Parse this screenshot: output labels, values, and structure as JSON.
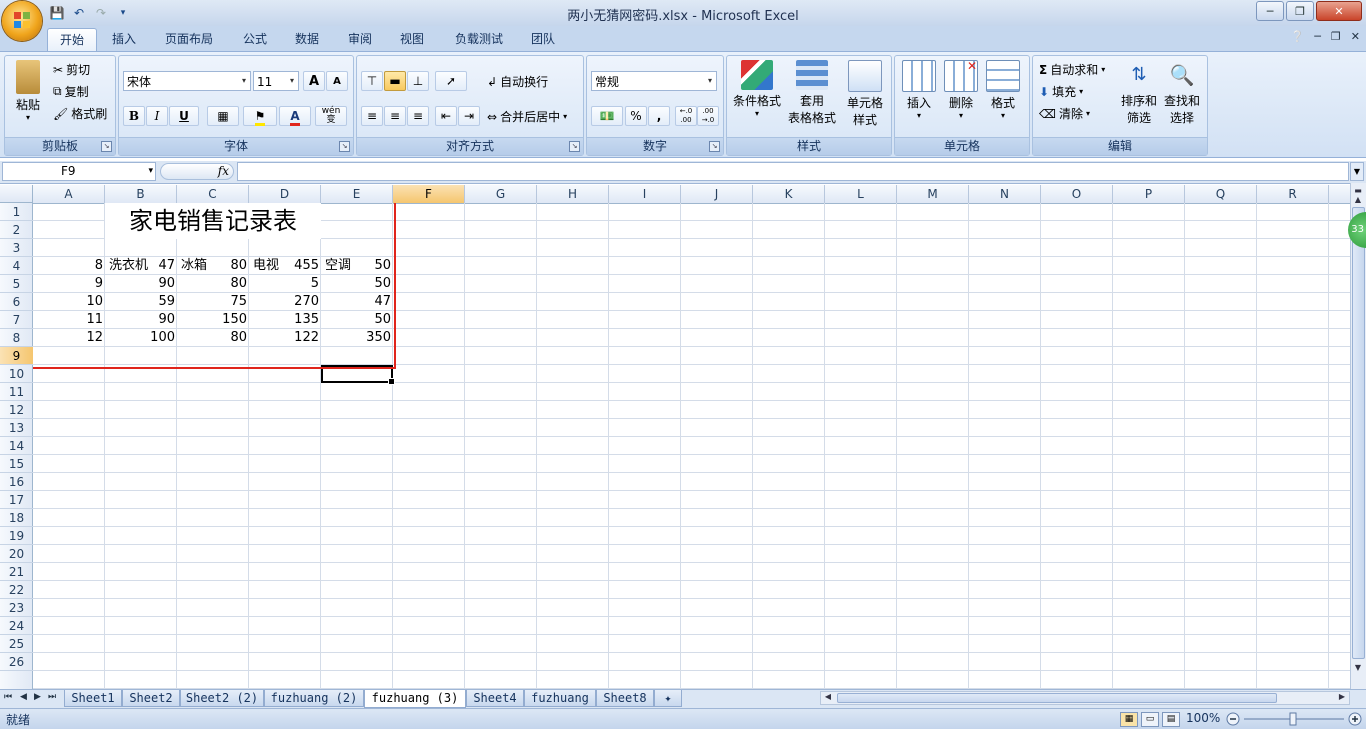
{
  "window": {
    "title": "两小无猜网密码.xlsx - Microsoft Excel",
    "controls": [
      "minimize",
      "restore",
      "close"
    ]
  },
  "ribbon_tabs": [
    {
      "label": "开始",
      "active": true
    },
    {
      "label": "插入"
    },
    {
      "label": "页面布局"
    },
    {
      "label": "公式"
    },
    {
      "label": "数据"
    },
    {
      "label": "审阅"
    },
    {
      "label": "视图"
    },
    {
      "label": "负载测试"
    },
    {
      "label": "团队"
    }
  ],
  "ribbon": {
    "clipboard": {
      "group": "剪贴板",
      "paste": "粘贴",
      "cut": "剪切",
      "copy": "复制",
      "format_painter": "格式刷"
    },
    "font": {
      "group": "字体",
      "name": "宋体",
      "size": "11",
      "bold": "B",
      "italic": "I",
      "underline": "U",
      "grow": "A",
      "shrink": "A",
      "phonetic": "wén 变"
    },
    "alignment": {
      "group": "对齐方式",
      "wrap": "自动换行",
      "merge": "合并后居中"
    },
    "number": {
      "group": "数字",
      "format": "常规",
      "percent": "%",
      "comma": ",",
      "inc_decimal": "←.0 .00",
      "dec_decimal": ".00 →.0"
    },
    "styles": {
      "group": "样式",
      "conditional": "条件格式",
      "table_1": "套用",
      "table_2": "表格格式",
      "cell_1": "单元格",
      "cell_2": "样式"
    },
    "cells": {
      "group": "单元格",
      "insert": "插入",
      "delete": "删除",
      "format": "格式"
    },
    "editing": {
      "group": "编辑",
      "autosum": "自动求和",
      "fill": "填充",
      "clear": "清除",
      "sort_1": "排序和",
      "sort_2": "筛选",
      "find_1": "查找和",
      "find_2": "选择"
    }
  },
  "formula_bar": {
    "name_box": "F9",
    "fx": "fx",
    "formula": ""
  },
  "columns": [
    "A",
    "B",
    "C",
    "D",
    "E",
    "F",
    "G",
    "H",
    "I",
    "J",
    "K",
    "L",
    "M",
    "N",
    "O",
    "P",
    "Q",
    "R",
    "S"
  ],
  "selected_column": "F",
  "rows": [
    "1",
    "2",
    "3",
    "4",
    "5",
    "6",
    "7",
    "8",
    "9",
    "10",
    "11",
    "12",
    "13",
    "14",
    "15",
    "16",
    "17",
    "18",
    "19",
    "20",
    "21",
    "22",
    "23",
    "24",
    "25",
    "26"
  ],
  "selected_row": "9",
  "sheet": {
    "title": "家电销售记录表",
    "headers": [
      "洗衣机",
      "冰箱",
      "电视",
      "空调"
    ],
    "data": [
      [
        "8",
        "47",
        "80",
        "455",
        "50"
      ],
      [
        "9",
        "90",
        "80",
        "5",
        "50"
      ],
      [
        "10",
        "59",
        "75",
        "270",
        "47"
      ],
      [
        "11",
        "90",
        "150",
        "135",
        "50"
      ],
      [
        "12",
        "100",
        "80",
        "122",
        "350"
      ]
    ]
  },
  "sheet_tabs": [
    {
      "label": "Sheet1"
    },
    {
      "label": "Sheet2"
    },
    {
      "label": "Sheet2 (2)"
    },
    {
      "label": "fuzhuang (2)"
    },
    {
      "label": "fuzhuang (3)",
      "active": true
    },
    {
      "label": "Sheet4"
    },
    {
      "label": "fuzhuang"
    },
    {
      "label": "Sheet8"
    }
  ],
  "status": {
    "text": "就绪",
    "zoom": "100%"
  },
  "side_badge": "33",
  "colors": {
    "accent_red": "#e0251c",
    "ribbon_blue": "#d2e1f4",
    "selected_header": "#f5c66f"
  }
}
